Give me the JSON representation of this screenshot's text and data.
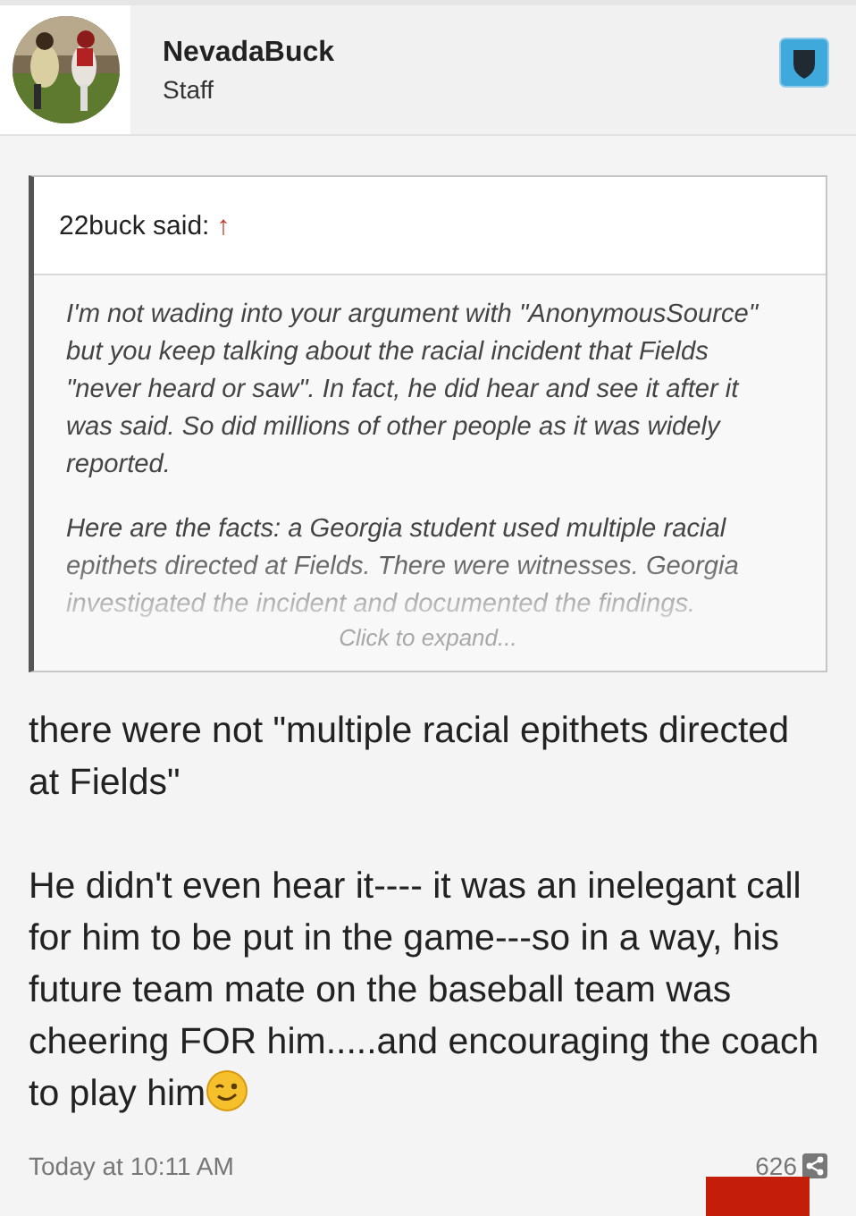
{
  "author": {
    "name": "NevadaBuck",
    "role": "Staff"
  },
  "quote": {
    "attribution": "22buck said:",
    "arrow": "↑",
    "paragraphs": [
      "I'm not wading into your argument with \"AnonymousSource\" but you keep talking about the racial incident that Fields \"never heard or saw\". In fact, he did hear and see it after it was said. So did millions of other people as it was widely reported.",
      "Here are the facts: a Georgia student used multiple racial epithets directed at Fields. There were witnesses. Georgia investigated the incident and documented the findings."
    ],
    "expand": "Click to expand..."
  },
  "message": {
    "paragraphs": [
      "there were not \"multiple racial epithets directed at Fields\"",
      "He didn't even hear it---- it was an inelegant call for him to be put in the game---so in a way, his future team mate on the baseball team was cheering FOR him.....and encouraging the coach to play him"
    ]
  },
  "footer": {
    "time": "Today at 10:11 AM",
    "count": "626"
  }
}
